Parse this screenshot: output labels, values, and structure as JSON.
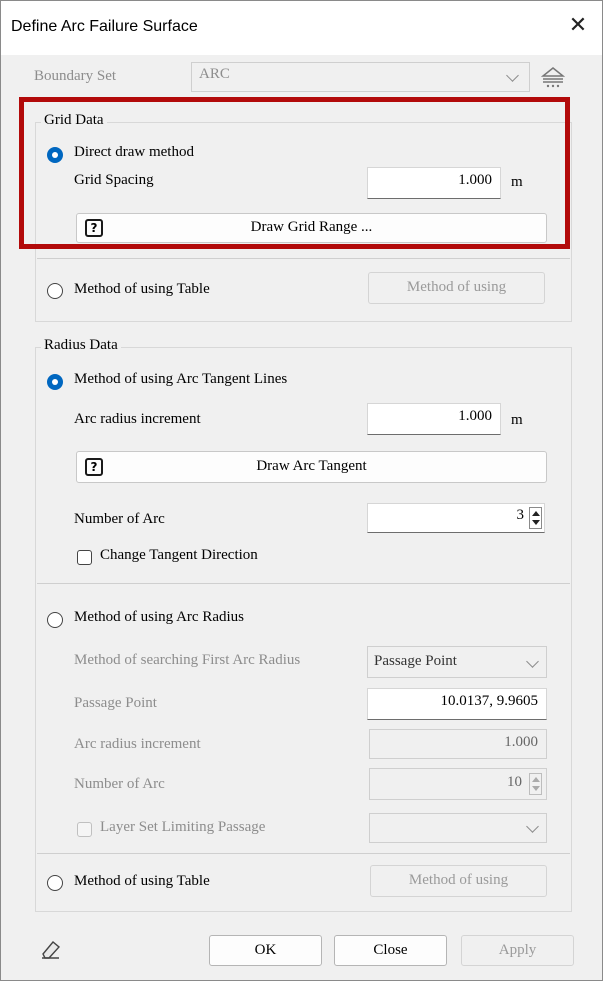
{
  "window": {
    "title": "Define Arc Failure Surface",
    "close_symbol": "✕"
  },
  "boundary_set": {
    "label": "Boundary Set",
    "value": "ARC",
    "icon": "layers-stack-icon"
  },
  "grid_data": {
    "title": "Grid Data",
    "direct_draw": {
      "label": "Direct draw method",
      "selected": true
    },
    "grid_spacing": {
      "label": "Grid Spacing",
      "value": "1.000",
      "unit": "m"
    },
    "draw_grid_button": {
      "icon_text": "?",
      "label": "Draw Grid Range ..."
    },
    "table_method": {
      "label": "Method of using Table",
      "selected": false
    },
    "table_button": "Method of using"
  },
  "radius_data": {
    "title": "Radius Data",
    "tangent_method": {
      "label": "Method of using Arc Tangent Lines",
      "selected": true
    },
    "arc_radius_increment": {
      "label": "Arc radius increment",
      "value": "1.000",
      "unit": "m"
    },
    "draw_arc_tangent_button": {
      "icon_text": "?",
      "label": "Draw Arc Tangent"
    },
    "number_of_arc": {
      "label": "Number of Arc",
      "value": "3"
    },
    "change_direction": {
      "label": "Change Tangent Direction",
      "checked": false
    },
    "radius_method": {
      "label": "Method of using Arc Radius",
      "selected": false
    },
    "search_method": {
      "label": "Method of searching First Arc Radius",
      "value": "Passage Point"
    },
    "passage_point": {
      "label": "Passage Point",
      "value": "10.0137, 9.9605"
    },
    "arc_radius_increment2": {
      "label": "Arc radius increment",
      "value": "1.000"
    },
    "number_of_arc2": {
      "label": "Number of Arc",
      "value": "10"
    },
    "layer_set": {
      "label": "Layer Set Limiting Passage",
      "checked": false
    },
    "table_method": {
      "label": "Method of using Table",
      "selected": false
    },
    "table_button": "Method of using"
  },
  "footer": {
    "eraser_icon": "eraser-icon",
    "ok": "OK",
    "close": "Close",
    "apply": "Apply"
  },
  "colors": {
    "accent": "#0067c0",
    "highlight_box": "#b20a0a"
  }
}
